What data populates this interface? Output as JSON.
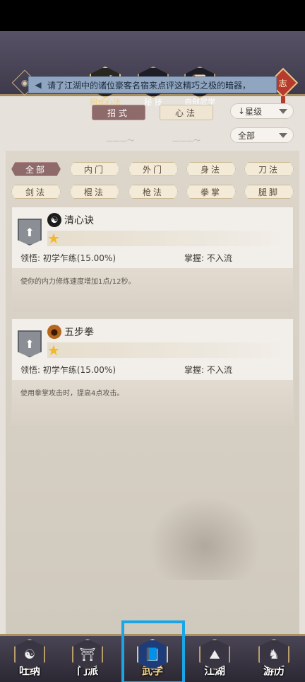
{
  "top_nav": {
    "tabs": [
      {
        "label": "招式心法",
        "icon": "sword-icon",
        "active": true
      },
      {
        "label": "秘 技",
        "icon": "book-icon",
        "active": false
      },
      {
        "label": "自创武学",
        "icon": "scroll-icon",
        "active": false
      }
    ],
    "eye_icon": "◉",
    "knot_label": "志",
    "ticker": {
      "icon": "horn-icon",
      "text": "请了江湖中的诸位豪客名宿来点评这精巧之极的暗器，"
    }
  },
  "sub_tabs": {
    "active": "招式",
    "other": "心法"
  },
  "sort_dropdown": {
    "value": "星级",
    "arrow": "↓"
  },
  "filter_dropdown": {
    "value": "全部"
  },
  "filters": [
    "全部",
    "内门",
    "外门",
    "身法",
    "刀法",
    "剑法",
    "棍法",
    "枪法",
    "拳掌",
    "腿脚"
  ],
  "skills": [
    {
      "name": "清心诀",
      "icon": "☯",
      "stars": "★",
      "comprehension_label": "领悟:",
      "comprehension_value": "初学乍练(15.00%)",
      "mastery_label": "掌握:",
      "mastery_value": "不入流",
      "description": "使你的内力修炼速度增加1点/12秒。"
    },
    {
      "name": "五步拳",
      "icon": "●",
      "stars": "★",
      "comprehension_label": "领悟:",
      "comprehension_value": "初学乍练(15.00%)",
      "mastery_label": "掌握:",
      "mastery_value": "不入流",
      "description": "使用拳掌攻击时，提高4点攻击。"
    }
  ],
  "bottom_nav": [
    {
      "label": "吐纳",
      "icon": "meditation-icon",
      "active": false
    },
    {
      "label": "门派",
      "icon": "sect-icon",
      "active": false
    },
    {
      "label": "武学",
      "icon": "martial-book-icon",
      "active": true
    },
    {
      "label": "江湖",
      "icon": "hat-icon",
      "active": false
    },
    {
      "label": "游历",
      "icon": "horse-icon",
      "active": false
    }
  ]
}
